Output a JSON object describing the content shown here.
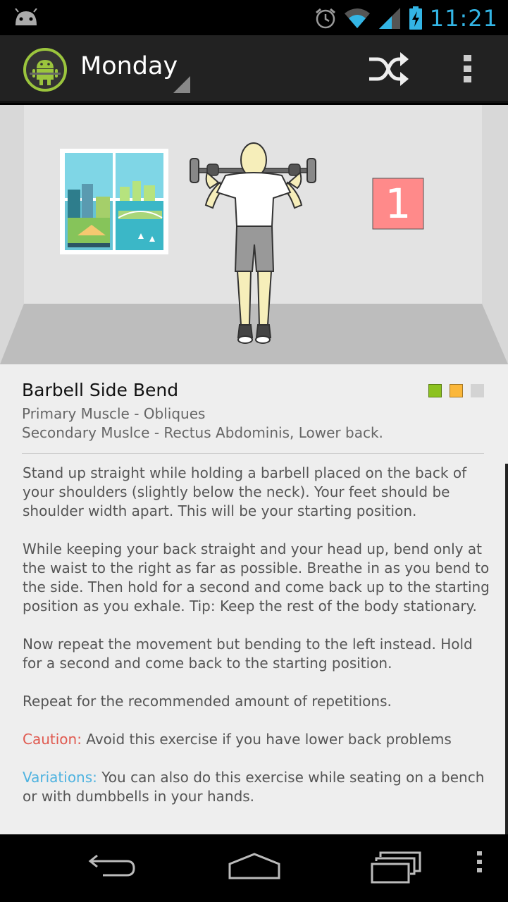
{
  "status_bar": {
    "time": "11:21",
    "icons": [
      "android-notification-icon",
      "alarm-icon",
      "wifi-icon",
      "signal-icon",
      "battery-charging-icon"
    ],
    "accent": "#33b5e5"
  },
  "action_bar": {
    "title": "Monday",
    "icons": [
      "app-logo-icon",
      "shuffle-icon",
      "overflow-menu-icon"
    ]
  },
  "scene": {
    "counter": "1",
    "counter_color": "#ff8a8a"
  },
  "exercise": {
    "name": "Barbell Side Bend",
    "primary": "Primary Muscle - Obliques",
    "secondary": "Secondary Muslce - Rectus Abdominis, Lower back.",
    "difficulty_colors": [
      "#8cc21f",
      "#fbb73a",
      "#d3d3d3"
    ],
    "paragraphs": [
      "Stand up straight while holding a barbell placed on the back of your shoulders (slightly below the neck). Your feet should be shoulder width apart. This will be your starting position.",
      "While keeping your back straight and your head up, bend only at the waist to the right as far as possible. Breathe in as you bend to the side. Then hold for a second and come back up to the starting position as you exhale. Tip: Keep the rest of the body stationary.",
      "Now repeat the movement but bending to the left instead. Hold for a second and come back to the starting position.",
      "Repeat for the recommended amount of repetitions."
    ],
    "caution_label": "Caution:",
    "caution_text": " Avoid this exercise if you have lower back problems",
    "variations_label": "Variations:",
    "variations_text": " You can also do this exercise while seating on a bench or with dumbbells in your hands."
  },
  "nav_bar": {
    "icons": [
      "back-icon",
      "home-icon",
      "recent-apps-icon",
      "menu-icon"
    ]
  }
}
